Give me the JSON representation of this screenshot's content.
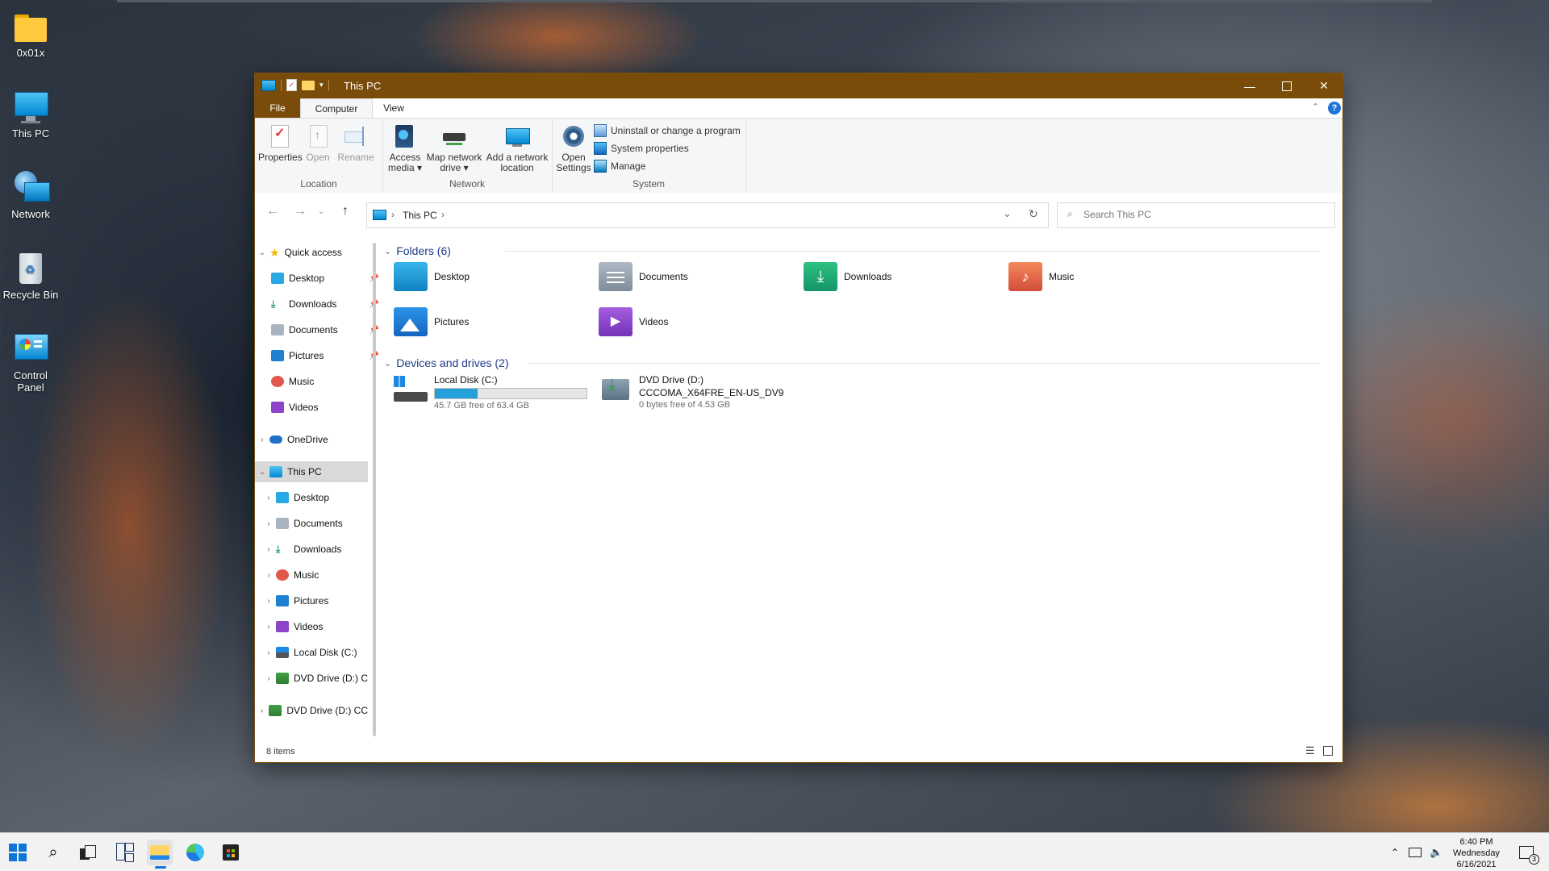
{
  "desktop": {
    "icons": [
      {
        "label": "0x01x",
        "icon": "folder-icon"
      },
      {
        "label": "This PC",
        "icon": "computer-icon"
      },
      {
        "label": "Network",
        "icon": "network-icon"
      },
      {
        "label": "Recycle Bin",
        "icon": "recycle-bin-icon"
      },
      {
        "label": "Control Panel",
        "icon": "control-panel-icon"
      }
    ]
  },
  "window": {
    "title": "This PC",
    "tabs": {
      "file": "File",
      "computer": "Computer",
      "view": "View"
    },
    "accent": "#7a4c0a"
  },
  "ribbon": {
    "location": {
      "label": "Location",
      "properties": "Properties",
      "open": "Open",
      "rename": "Rename"
    },
    "network": {
      "label": "Network",
      "access_media_1": "Access",
      "access_media_2": "media ▾",
      "map_drive_1": "Map network",
      "map_drive_2": "drive ▾",
      "add_location_1": "Add a network",
      "add_location_2": "location"
    },
    "system": {
      "label": "System",
      "open_settings_1": "Open",
      "open_settings_2": "Settings",
      "uninstall": "Uninstall or change a program",
      "system_properties": "System properties",
      "manage": "Manage"
    }
  },
  "nav": {
    "address_root": "This PC",
    "search_placeholder": "Search This PC"
  },
  "navpane": {
    "quick_access": "Quick access",
    "quick_items": [
      "Desktop",
      "Downloads",
      "Documents",
      "Pictures",
      "Music",
      "Videos"
    ],
    "onedrive": "OneDrive",
    "this_pc": "This PC",
    "pc_items": [
      "Desktop",
      "Documents",
      "Downloads",
      "Music",
      "Pictures",
      "Videos",
      "Local Disk (C:)",
      "DVD Drive (D:) C"
    ],
    "dvd": "DVD Drive (D:) CC"
  },
  "content": {
    "folders_header": "Folders (6)",
    "folders": [
      "Desktop",
      "Documents",
      "Downloads",
      "Music",
      "Pictures",
      "Videos"
    ],
    "devices_header": "Devices and drives (2)",
    "drive_c": {
      "name": "Local Disk (C:)",
      "free": "45.7 GB free of 63.4 GB",
      "used_fraction": 0.28
    },
    "drive_d": {
      "name": "DVD Drive (D:)",
      "label": "CCCOMA_X64FRE_EN-US_DV9",
      "free": "0 bytes free of 4.53 GB"
    }
  },
  "status": {
    "items": "8 items"
  },
  "taskbar": {
    "time": "6:40 PM",
    "day": "Wednesday",
    "date": "6/16/2021",
    "notifications": "3"
  }
}
